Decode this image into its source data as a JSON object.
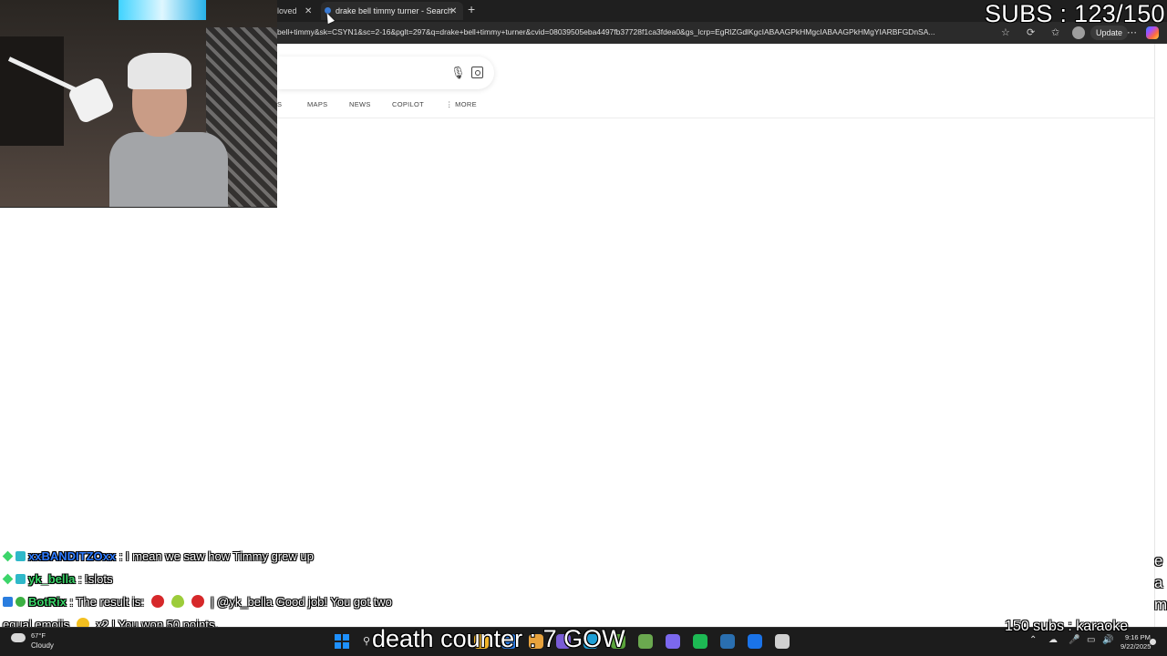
{
  "overlay": {
    "subs": "SUBS : 123/150",
    "karaoke": "150 subs : karaoke",
    "death_counter": "death counter : 7 GOW",
    "ticker_letters": [
      "e",
      "a",
      "m"
    ]
  },
  "browser": {
    "tabs": [
      {
        "label": "loved ",
        "active": false
      },
      {
        "label": "drake bell timmy turner - Search",
        "active": true
      }
    ],
    "url": "bell+timmy&sk=CSYN1&sc=2-16&pglt=297&q=drake+bell+timmy+turner&cvid=08039505eba4497fb37728f1ca3fdea0&gs_lcrp=EgRlZGdlKgcIABAAGPkHMgcIABAAGPkHMgYIARBFGDnSA...",
    "update_label": "Update",
    "icons": {
      "close": "close-icon",
      "new_tab": "plus-icon",
      "star": "star-icon",
      "favorites": "favorites-icon",
      "refresh": "refresh-icon",
      "more": "more-icon"
    }
  },
  "search": {
    "nav_tabs": [
      "S",
      "MAPS",
      "NEWS",
      "COPILOT",
      "⋮ MORE"
    ]
  },
  "chat": [
    {
      "user": "xxBANDITZOxx",
      "user_color": "#2e7bff",
      "message": " : I mean we saw how Timmy grew up",
      "badges": [
        "gem",
        "hype"
      ]
    },
    {
      "user": "yk_bella",
      "user_color": "#3cd56a",
      "message": " : !slots",
      "badges": [
        "gem",
        "hype"
      ]
    },
    {
      "user": "BotRix",
      "user_color": "#3cd56a",
      "message_pre": " : The result is: ",
      "message_post": " | @yk_bella Good job! You got two",
      "badges": [
        "bot",
        "check"
      ]
    },
    {
      "message": "equal emojis ",
      "message_post": " x2 ! You won 50 points."
    }
  ],
  "taskbar": {
    "weather_temp": "67°F",
    "weather_condition": "Cloudy",
    "time": "9:16 PM",
    "date": "9/22/2025",
    "apps": [
      "#f0b429",
      "#2b7be4",
      "#e8a33d",
      "#7a5cd6",
      "#1e9fd6",
      "#5aa33b",
      "#6aa84f",
      "#7b68ee",
      "#1db954",
      "#2a6fb0",
      "#1a73e8",
      "#d0d0d0"
    ]
  }
}
